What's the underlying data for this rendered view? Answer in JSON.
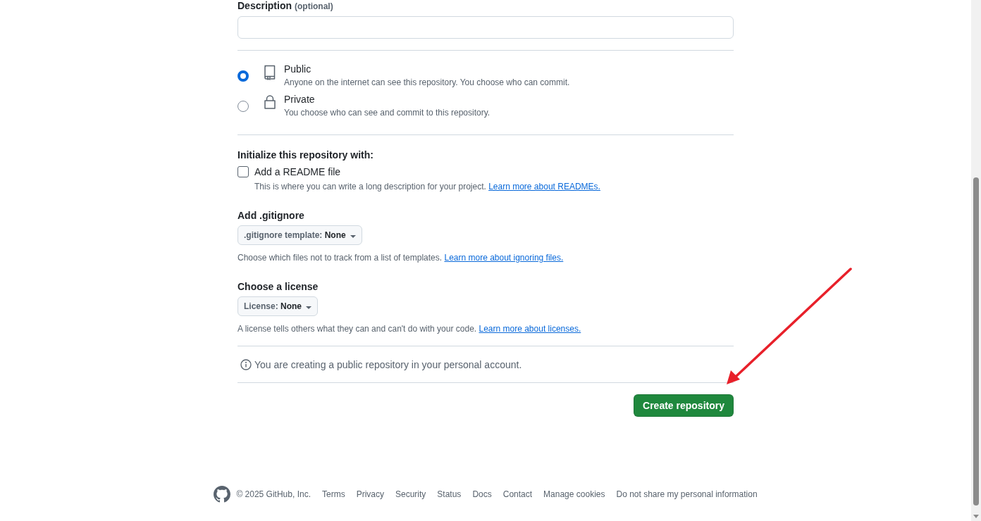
{
  "description_field": {
    "label": "Description",
    "hint": "(optional)"
  },
  "visibility": [
    {
      "kind": "book",
      "label": "Public",
      "description": "Anyone on the internet can see this repository. You choose who can commit.",
      "selected": true
    },
    {
      "kind": "lock",
      "label": "Private",
      "description": "You choose who can see and commit to this repository.",
      "selected": false
    }
  ],
  "initialize": {
    "heading": "Initialize this repository with:",
    "readme": {
      "label": "Add a README file",
      "checked": false,
      "description": "This is where you can write a long description for your project.",
      "link": "Learn more about READMEs."
    }
  },
  "gitignore": {
    "heading": "Add .gitignore",
    "dropdown_label": ".gitignore template:",
    "dropdown_value": "None",
    "description": "Choose which files not to track from a list of templates.",
    "link": "Learn more about ignoring files."
  },
  "license": {
    "heading": "Choose a license",
    "dropdown_label": "License:",
    "dropdown_value": "None",
    "description": "A license tells others what they can and can't do with your code.",
    "link": "Learn more about licenses."
  },
  "notice": "You are creating a public repository in your personal account.",
  "submit_button": "Create repository",
  "footer": {
    "copyright": "© 2025 GitHub, Inc.",
    "links": [
      "Terms",
      "Privacy",
      "Security",
      "Status",
      "Docs",
      "Contact",
      "Manage cookies",
      "Do not share my personal information"
    ]
  }
}
